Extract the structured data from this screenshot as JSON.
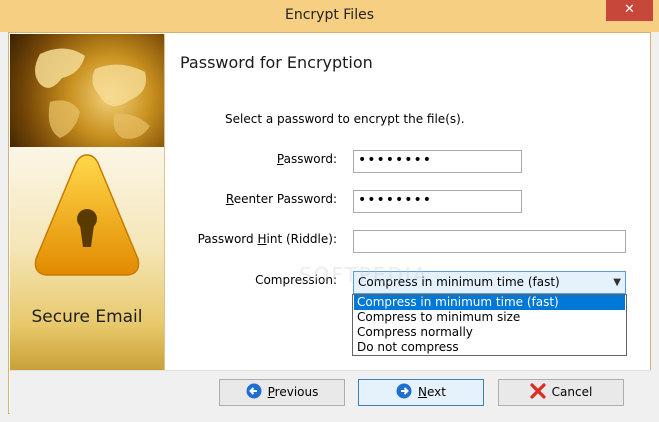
{
  "window": {
    "title": "Encrypt Files",
    "close_glyph": "✕"
  },
  "sidebar": {
    "product_label": "Secure Email",
    "top_image": "world-map-image",
    "logo": "warning-keyhole-logo"
  },
  "page": {
    "heading": "Password for Encryption",
    "instruction": "Select a password to encrypt the file(s)."
  },
  "fields": {
    "password": {
      "label_accel": "P",
      "label_rest": "assword:",
      "value": "••••••••"
    },
    "reenter": {
      "label_accel": "R",
      "label_rest": "eenter Password:",
      "value": "••••••••"
    },
    "hint": {
      "label_pre": "Password ",
      "label_accel": "H",
      "label_rest": "int (Riddle):",
      "value": ""
    },
    "compression": {
      "label": "Compression:",
      "selected": "Compress in minimum time (fast)",
      "options": [
        "Compress in minimum time (fast)",
        "Compress to minimum size",
        "Compress normally",
        "Do not compress"
      ]
    }
  },
  "buttons": {
    "previous": {
      "accel": "P",
      "rest": "revious",
      "icon": "arrow-left-icon"
    },
    "next": {
      "accel": "N",
      "rest": "ext",
      "icon": "arrow-right-icon"
    },
    "cancel": {
      "label": "Cancel",
      "icon": "red-x-icon"
    }
  },
  "watermark": "SOFTPEDIA",
  "colors": {
    "title_bar": "#f7cf83",
    "accent": "#0078d7",
    "close": "#c7473a"
  }
}
